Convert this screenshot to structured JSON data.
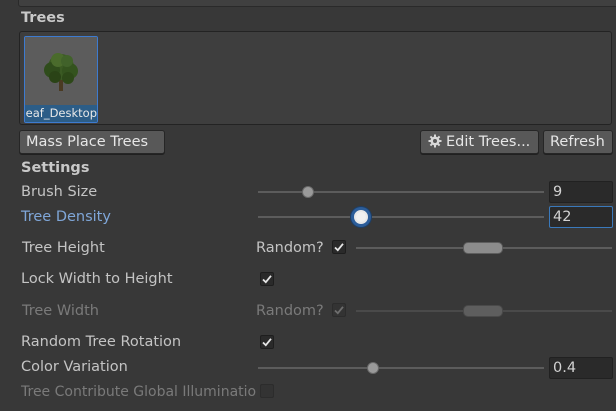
{
  "trees": {
    "section_title": "Trees",
    "thumbnail": {
      "label": "Broadleaf_Desktop",
      "selected": true
    }
  },
  "buttons": {
    "mass_place": "Mass Place Trees",
    "edit_trees": "Edit Trees...",
    "refresh": "Refresh"
  },
  "settings": {
    "title": "Settings",
    "brush_size": {
      "label": "Brush Size",
      "value": "9",
      "slider_fraction": 0.17
    },
    "tree_density": {
      "label": "Tree Density",
      "value": "42",
      "slider_fraction": 0.35
    },
    "tree_height": {
      "label": "Tree Height",
      "random_label": "Random?",
      "random": true,
      "range": [
        0.8,
        1.2
      ]
    },
    "lock_width": {
      "label": "Lock Width to Height",
      "checked": true
    },
    "tree_width": {
      "label": "Tree Width",
      "random_label": "Random?",
      "random": true,
      "range": [
        0.8,
        1.2
      ],
      "enabled": false
    },
    "random_rotation": {
      "label": "Random Tree Rotation",
      "checked": true
    },
    "color_variation": {
      "label": "Color Variation",
      "value": "0.4",
      "slider_fraction": 0.4
    },
    "global_illumination": {
      "label": "Tree Contribute Global Illuminatio",
      "checked": false,
      "enabled": false
    }
  },
  "colors": {
    "background": "#383838",
    "accent": "#3a79bb",
    "focus_label": "#7fa6d8"
  },
  "icons": {
    "edit": "gear-icon",
    "check": "checkmark-icon",
    "tree": "tree-thumbnail-icon"
  }
}
